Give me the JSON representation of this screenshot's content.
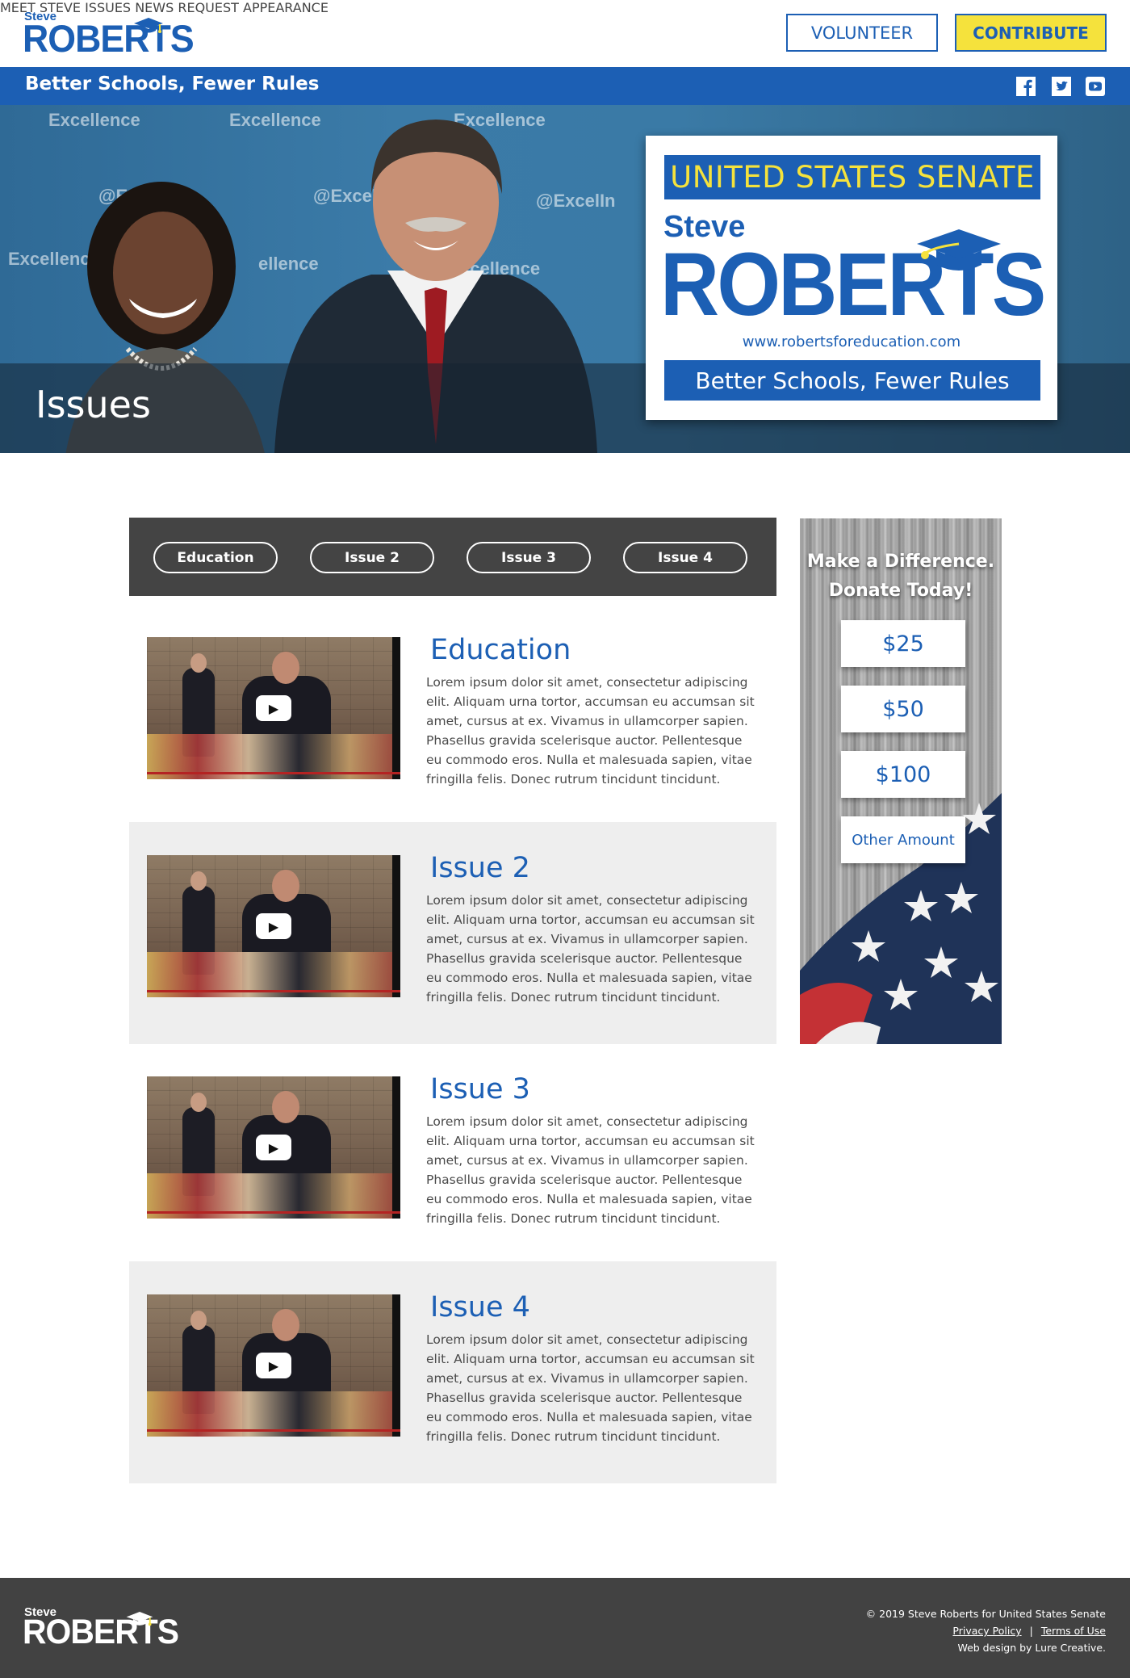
{
  "header": {
    "logo": {
      "first": "Steve",
      "last": "ROBERTS"
    },
    "nav": [
      "MEET STEVE",
      "ISSUES",
      "NEWS",
      "REQUEST APPEARANCE"
    ],
    "volunteer_label": "VOLUNTEER",
    "contribute_label": "CONTRIBUTE"
  },
  "tagline": "Better Schools, Fewer Rules",
  "social": [
    "facebook-icon",
    "twitter-icon",
    "youtube-icon"
  ],
  "hero": {
    "page_title": "Issues",
    "backdrop_text": [
      "Excellence",
      "Excellence",
      "Excellence",
      "@Excel",
      "@Excel",
      "@ExcelIn",
      "Excellence",
      "ellence",
      "xcellence"
    ],
    "sign": {
      "top_band": "UNITED STATES SENATE",
      "first": "Steve",
      "last": "ROBERTS",
      "url": "www.robertsforeducation.com",
      "bottom_band": "Better Schools, Fewer Rules"
    }
  },
  "tabs": [
    "Education",
    "Issue 2",
    "Issue 3",
    "Issue 4"
  ],
  "issues": [
    {
      "title": "Education",
      "body": "Lorem ipsum dolor sit amet, consectetur adipiscing elit. Aliquam urna tortor, accumsan eu accumsan sit amet, cursus at ex. Vivamus in ullamcorper sapien. Phasellus gravida scelerisque auctor. Pellentesque eu commodo eros. Nulla et malesuada sapien, vitae fringilla felis. Donec rutrum tincidunt tincidunt."
    },
    {
      "title": "Issue 2",
      "body": "Lorem ipsum dolor sit amet, consectetur adipiscing elit. Aliquam urna tortor, accumsan eu accumsan sit amet, cursus at ex. Vivamus in ullamcorper sapien. Phasellus gravida scelerisque auctor. Pellentesque eu commodo eros. Nulla et malesuada sapien, vitae fringilla felis. Donec rutrum tincidunt tincidunt."
    },
    {
      "title": "Issue 3",
      "body": "Lorem ipsum dolor sit amet, consectetur adipiscing elit. Aliquam urna tortor, accumsan eu accumsan sit amet, cursus at ex. Vivamus in ullamcorper sapien. Phasellus gravida scelerisque auctor. Pellentesque eu commodo eros. Nulla et malesuada sapien, vitae fringilla felis. Donec rutrum tincidunt tincidunt."
    },
    {
      "title": "Issue 4",
      "body": "Lorem ipsum dolor sit amet, consectetur adipiscing elit. Aliquam urna tortor, accumsan eu accumsan sit amet, cursus at ex. Vivamus in ullamcorper sapien. Phasellus gravida scelerisque auctor. Pellentesque eu commodo eros. Nulla et malesuada sapien, vitae fringilla felis. Donec rutrum tincidunt tincidunt."
    }
  ],
  "video": {
    "play_icon": "play-icon",
    "play_glyph": "▶"
  },
  "donate": {
    "heading_line1": "Make a Difference.",
    "heading_line2": "Donate Today!",
    "amounts": [
      "$25",
      "$50",
      "$100"
    ],
    "other_label": "Other Amount"
  },
  "footer": {
    "logo": {
      "first": "Steve",
      "last": "ROBERTS"
    },
    "copyright": "© 2019 Steve Roberts for United States Senate",
    "privacy": "Privacy Policy",
    "separator": "|",
    "terms": "Terms of Use",
    "credit": "Web design by Lure Creative."
  },
  "colors": {
    "brand_blue": "#1c5fb4",
    "accent_yellow": "#f5e23c",
    "dark_gray": "#444444",
    "footer_gray": "#424242",
    "shade": "#eeeeee"
  }
}
